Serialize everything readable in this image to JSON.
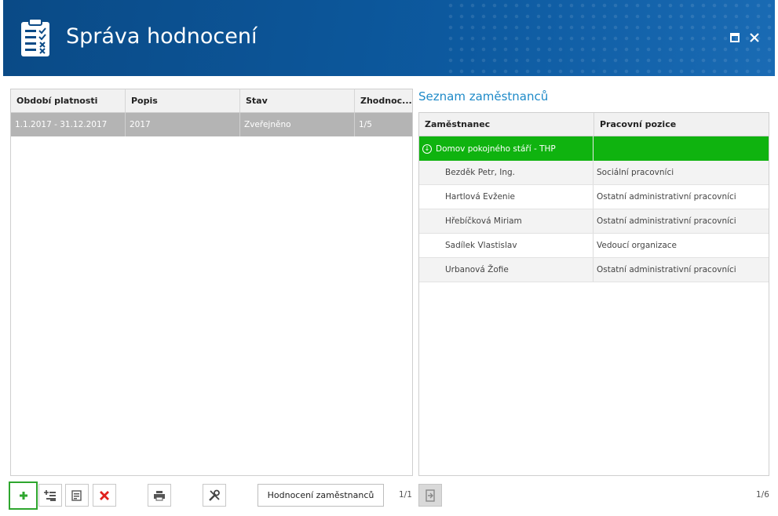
{
  "header": {
    "title": "Správa hodnocení"
  },
  "left_table": {
    "columns": [
      "Období platnosti",
      "Popis",
      "Stav",
      "Zhodnoc..."
    ],
    "rows": [
      [
        "1.1.2017 - 31.12.2017",
        "2017",
        "Zveřejněno",
        "1/5"
      ]
    ]
  },
  "right": {
    "title": "Seznam zaměstnanců",
    "columns": [
      "Zaměstnanec",
      "Pracovní pozice"
    ],
    "group": "Domov pokojného stáří - THP",
    "employees": [
      {
        "name": "Bezděk Petr, Ing.",
        "position": "Sociální pracovníci"
      },
      {
        "name": "Hartlová Evženie",
        "position": "Ostatní administrativní pracovníci"
      },
      {
        "name": "Hřebíčková Miriam",
        "position": "Ostatní administrativní pracovníci"
      },
      {
        "name": "Sadílek Vlastislav",
        "position": "Vedoucí organizace"
      },
      {
        "name": "Urbanová Žofie",
        "position": "Ostatní administrativní pracovníci"
      }
    ],
    "pager": "1/6"
  },
  "toolbar": {
    "evaluate_label": "Hodnocení zaměstnanců",
    "left_pager": "1/1"
  },
  "colors": {
    "header": "#0a4a86",
    "group_row": "#0fb30f",
    "accent": "#1e8ac8"
  }
}
